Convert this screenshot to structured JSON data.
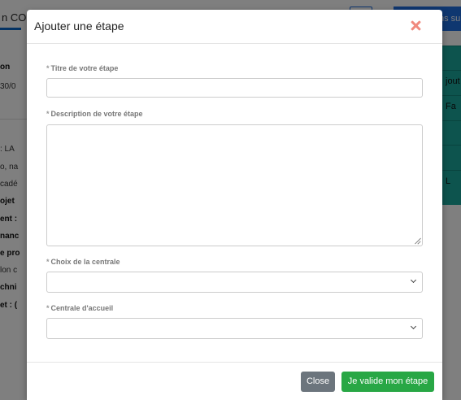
{
  "background": {
    "title_fragment": "n CO",
    "top_button_fragment": "ns su",
    "left_labels": [
      {
        "text": "on",
        "bold": true
      },
      {
        "text": "30/0",
        "bold": false
      },
      {
        "text": ": LA",
        "bold": false
      },
      {
        "text": "o, na",
        "bold": false
      },
      {
        "text": "cadé",
        "bold": false
      },
      {
        "text": "ojet",
        "bold": true
      },
      {
        "text": "ent :",
        "bold": true
      },
      {
        "text": "nanc",
        "bold": true
      },
      {
        "text": "e pro",
        "bold": true
      },
      {
        "text": "lon c",
        "bold": false
      },
      {
        "text": "chni",
        "bold": true
      },
      {
        "text": "et : (",
        "bold": true
      }
    ],
    "right_buttons": [
      "",
      "jout",
      "Fa",
      "",
      "",
      "L"
    ],
    "colors": {
      "accent_blue": "#1f6fe0",
      "teal": "#1aa89c"
    }
  },
  "modal": {
    "title": "Ajouter une étape",
    "close_icon": "close-icon",
    "fields": {
      "titre": {
        "required_mark": "*",
        "label": "Titre de votre étape",
        "value": "",
        "placeholder": ""
      },
      "description": {
        "required_mark": "*",
        "label": "Description de votre étape",
        "value": "",
        "placeholder": ""
      },
      "centrale": {
        "required_mark": "*",
        "label": "Choix de la centrale",
        "selected": ""
      },
      "centrale_accueil": {
        "required_mark": "*",
        "label": "Centrale d'accueil",
        "selected": ""
      }
    },
    "buttons": {
      "close": "Close",
      "submit": "Je valide mon étape"
    },
    "colors": {
      "close_icon": "#f08a7e",
      "close_button": "#6c757d",
      "submit_button": "#28a745"
    }
  }
}
